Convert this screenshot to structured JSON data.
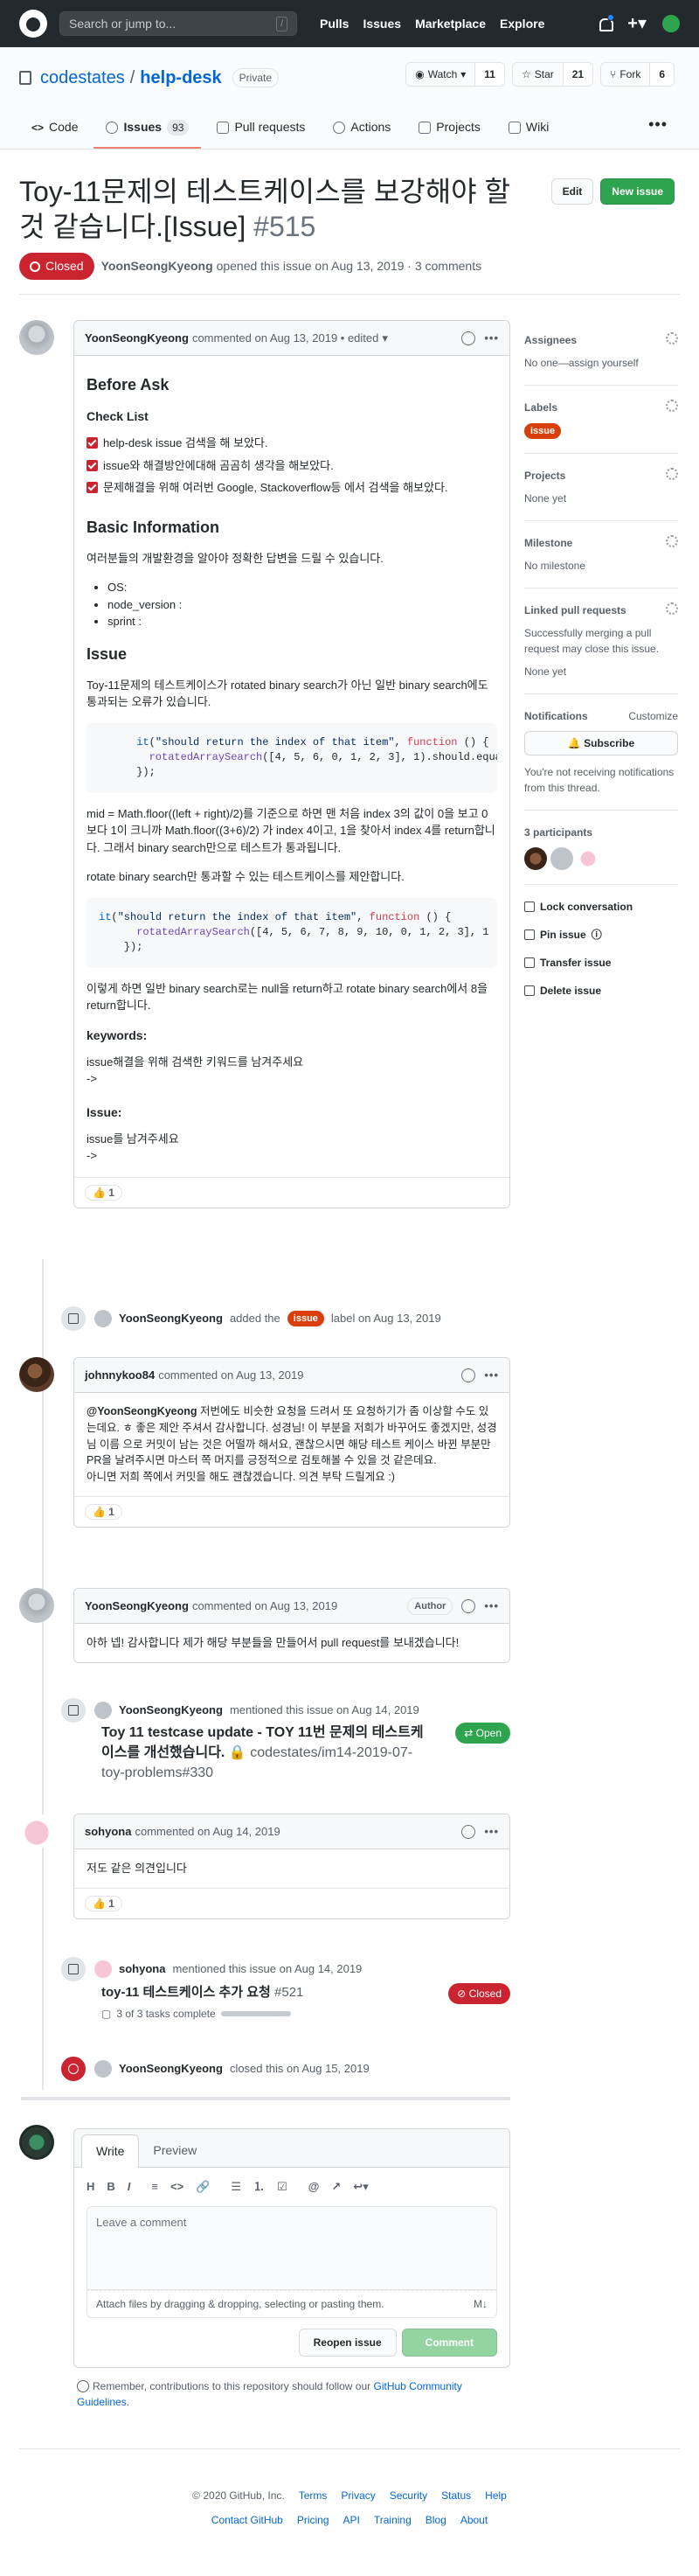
{
  "header": {
    "search_placeholder": "Search or jump to...",
    "search_key": "/",
    "nav": [
      "Pulls",
      "Issues",
      "Marketplace",
      "Explore"
    ]
  },
  "repo": {
    "owner": "codestates",
    "separator": "/",
    "name": "help-desk",
    "visibility": "Private",
    "watch_label": "Watch",
    "watch_count": "11",
    "star_label": "Star",
    "star_count": "21",
    "fork_label": "Fork",
    "fork_count": "6",
    "tabs": {
      "code": "Code",
      "issues": "Issues",
      "issues_count": "93",
      "pulls": "Pull requests",
      "actions": "Actions",
      "projects": "Projects",
      "wiki": "Wiki"
    }
  },
  "issue": {
    "title": "Toy-11문제의 테스트케이스를 보강해야 할 것 같습니다.[Issue]",
    "number": "#515",
    "edit_label": "Edit",
    "new_issue_label": "New issue",
    "state": "Closed",
    "author": "YoonSeongKyeong",
    "opened_text": "opened this issue on Aug 13, 2019 · 3 comments"
  },
  "first_comment": {
    "author": "YoonSeongKyeong",
    "meta": "commented on Aug 13, 2019 • edited",
    "before_ask": "Before Ask",
    "check_list": "Check List",
    "tasks": [
      "help-desk issue 검색을 해 보았다.",
      "issue와 해결방안에대해 곰곰히 생각을 해보았다.",
      "문제해결을 위해 여러번 Google, Stackoverflow등 에서 검색을 해보았다."
    ],
    "basic_info": "Basic Information",
    "basic_info_text": "여러분들의 개발환경을 알아야 정확한 답변을 드릴 수 있습니다.",
    "env": [
      "OS:",
      "node_version :",
      "sprint :"
    ],
    "issue_heading": "Issue",
    "issue_text": "Toy-11문제의 테스트케이스가 rotated binary search가 아닌 일반 binary search에도 통과되는 오류가 있습니다.",
    "code1": {
      "indent": "      ",
      "it": "it",
      "str": "\"should return the index of that item\"",
      "fn": "function",
      "line2_indent": "        ",
      "line2_call": "rotatedArraySearch",
      "line2_args": "([4, 5, 6, 0, 1, 2, 3], 1).should.equa",
      "line3": "      });"
    },
    "explain1": "mid = Math.floor((left + right)/2)를 기준으로 하면 맨 처음 index 3의 값이 0을 보고 0보다 1이 크니까 Math.floor((3+6)/2) 가 index 4이고, 1을 찾아서 index 4를 return합니다. 그래서 binary search만으로 테스트가 통과됩니다.",
    "explain2": "rotate binary search만 통과할 수 있는 테스트케이스를 제안합니다.",
    "code2": {
      "it": "it",
      "str": "\"should return the index of that item\"",
      "fn": "function",
      "line2_indent": "      ",
      "line2_call": "rotatedArraySearch",
      "line2_args": "([4, 5, 6, 7, 8, 9, 10, 0, 1, 2, 3], 1",
      "line3": "    });"
    },
    "explain3": "이렇게 하면 일반 binary search로는 null을 return하고 rotate binary search에서 8을 return합니다.",
    "keywords_label": "keywords:",
    "keywords_text": "issue해결을 위해 검색한 키워드를 남겨주세요",
    "arrow": "->",
    "issue_label": "Issue:",
    "issue_leave": "issue를 남겨주세요",
    "reaction_count": "1"
  },
  "label_event": {
    "user": "YoonSeongKyeong",
    "before": "added the",
    "label": "issue",
    "after": "label on Aug 13, 2019"
  },
  "comment2": {
    "author": "johnnykoo84",
    "meta": "commented on Aug 13, 2019",
    "mention": "@YoonSeongKyeong",
    "text": " 저번에도 비슷한 요청을 드려서 또 요청하기가 좀 이상할 수도 있는데요. ㅎ 좋은 제안 주셔서 감사합니다. 성경님! 이 부분을 저희가 바꾸어도 좋겠지만, 성경님 이름 으로 커밋이 남는 것은 어떨까 해서요, 괜찮으시면 해당 테스트 케이스 바뀐 부분만 PR을 날려주시면 마스터 쪽 머지를 긍정적으로 검토해볼 수 있을 것 같은데요.",
    "text2": "아니면 저희 쪽에서 커밋을 해도 괜찮겠습니다. 의견 부탁 드릴게요 :)",
    "reaction_count": "1"
  },
  "comment3": {
    "author": "YoonSeongKyeong",
    "meta": "commented on Aug 13, 2019",
    "tag": "Author",
    "text": "아하 넵! 감사합니다 제가 해당 부분들을 만들어서 pull request를 보내겠습니다!"
  },
  "mention_event1": {
    "user": "YoonSeongKyeong",
    "text": "mentioned this issue on Aug 14, 2019",
    "ref_title": "Toy 11 testcase update - TOY 11번 문제의 테스트케이스를 개선했습니다.",
    "ref_sub": "codestates/im14-2019-07-toy-problems#330",
    "badge": "Open"
  },
  "comment4": {
    "author": "sohyona",
    "meta": "commented on Aug 14, 2019",
    "text": "저도 같은 의견입니다",
    "reaction_count": "1"
  },
  "mention_event2": {
    "user": "sohyona",
    "text": "mentioned this issue on Aug 14, 2019",
    "ref_title": "toy-11 테스트케이스 추가 요청",
    "ref_num": "#521",
    "tasks": "3 of 3 tasks complete",
    "tasks_fraction": 1.0,
    "badge": "Closed"
  },
  "close_event": {
    "user": "YoonSeongKyeong",
    "text": "closed this on Aug 15, 2019"
  },
  "form": {
    "write": "Write",
    "preview": "Preview",
    "toolbar": [
      "H",
      "B",
      "I"
    ],
    "placeholder": "Leave a comment",
    "attach": "Attach files by dragging & dropping, selecting or pasting them.",
    "reopen": "Reopen issue",
    "comment": "Comment",
    "remember": "Remember, contributions to this repository should follow our",
    "guidelines": "GitHub Community Guidelines",
    "period": "."
  },
  "sidebar": {
    "assignees": "Assignees",
    "assignees_val": "No one—assign yourself",
    "labels": "Labels",
    "label_val": "issue",
    "projects": "Projects",
    "projects_val": "None yet",
    "milestone": "Milestone",
    "milestone_val": "No milestone",
    "linked": "Linked pull requests",
    "linked_text": "Successfully merging a pull request may close this issue.",
    "linked_val": "None yet",
    "notifications": "Notifications",
    "customize": "Customize",
    "subscribe": "Subscribe",
    "not_receiving": "You're not receiving notifications from this thread.",
    "participants": "3 participants",
    "lock": "Lock conversation",
    "pin": "Pin issue",
    "transfer": "Transfer issue",
    "delete": "Delete issue"
  },
  "footer": {
    "copyright": "© 2020 GitHub, Inc.",
    "row1": [
      "Terms",
      "Privacy",
      "Security",
      "Status",
      "Help"
    ],
    "row2": [
      "Contact GitHub",
      "Pricing",
      "API",
      "Training",
      "Blog",
      "About"
    ]
  }
}
